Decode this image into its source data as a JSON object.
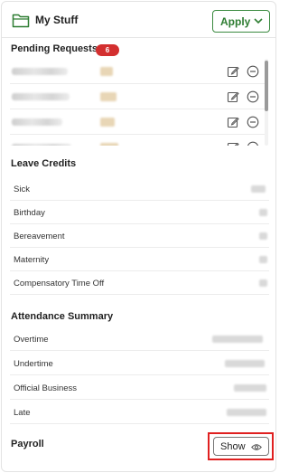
{
  "header": {
    "title": "My Stuff",
    "apply_label": "Apply",
    "icons": {
      "folder": "folder-icon",
      "chevron": "chevron-down-icon"
    }
  },
  "pending": {
    "title": "Pending Requests",
    "count": "6",
    "badge_color": "#d32f2f",
    "rows": [
      {
        "edit_icon": "edit-icon",
        "cancel_icon": "minus-circle-icon"
      },
      {
        "edit_icon": "edit-icon",
        "cancel_icon": "minus-circle-icon"
      },
      {
        "edit_icon": "edit-icon",
        "cancel_icon": "minus-circle-icon"
      },
      {
        "edit_icon": "edit-icon",
        "cancel_icon": "minus-circle-icon"
      }
    ]
  },
  "leave": {
    "title": "Leave Credits",
    "items": [
      {
        "label": "Sick"
      },
      {
        "label": "Birthday"
      },
      {
        "label": "Bereavement"
      },
      {
        "label": "Maternity"
      },
      {
        "label": "Compensatory Time Off"
      }
    ]
  },
  "attendance": {
    "title": "Attendance Summary",
    "items": [
      {
        "label": "Overtime"
      },
      {
        "label": "Undertime"
      },
      {
        "label": "Official Business"
      },
      {
        "label": "Late"
      }
    ]
  },
  "payroll": {
    "title": "Payroll",
    "show_label": "Show",
    "show_icon": "eye-icon"
  },
  "colors": {
    "accent_green": "#2e7d32",
    "highlight_red": "#e02020"
  }
}
